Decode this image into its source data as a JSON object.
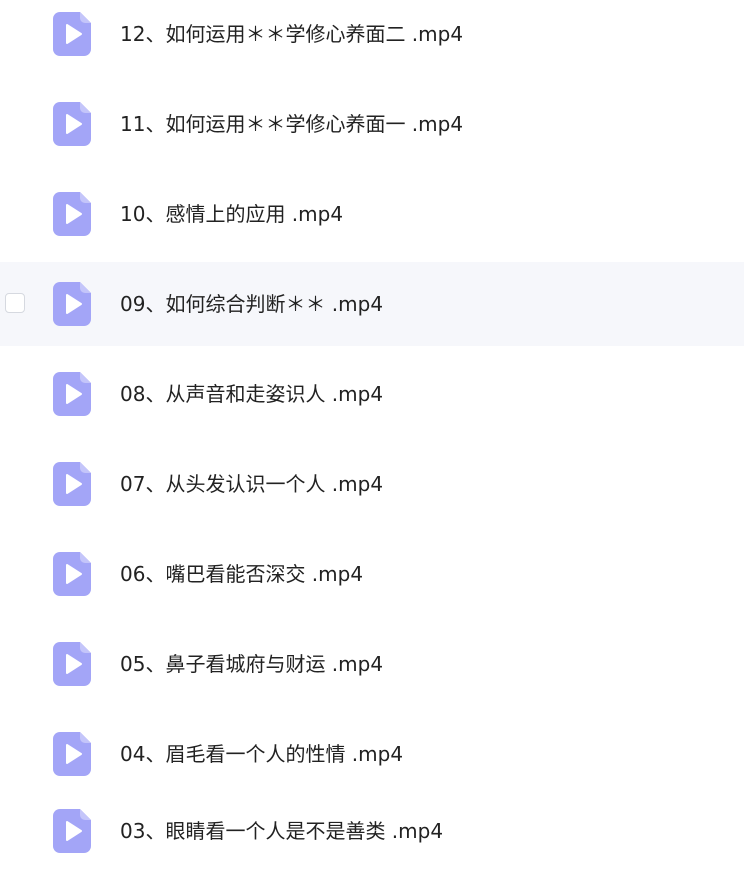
{
  "file_list": {
    "item_icon": "video-file-icon",
    "icon_color": "#a3a5f7",
    "hover_background": "#f6f7fb",
    "items": [
      {
        "name": "12、如何运用＊＊学修心养面二 .mp4",
        "hovered": false
      },
      {
        "name": "11、如何运用＊＊学修心养面一 .mp4",
        "hovered": false
      },
      {
        "name": "10、感情上的应用 .mp4",
        "hovered": false
      },
      {
        "name": "09、如何综合判断＊＊ .mp4",
        "hovered": true
      },
      {
        "name": "08、从声音和走姿识人 .mp4",
        "hovered": false
      },
      {
        "name": "07、从头发认识一个人 .mp4",
        "hovered": false
      },
      {
        "name": "06、嘴巴看能否深交 .mp4",
        "hovered": false
      },
      {
        "name": "05、鼻子看城府与财运 .mp4",
        "hovered": false
      },
      {
        "name": "04、眉毛看一个人的性情 .mp4",
        "hovered": false
      },
      {
        "name": "03、眼睛看一个人是不是善类 .mp4",
        "hovered": false
      }
    ]
  }
}
